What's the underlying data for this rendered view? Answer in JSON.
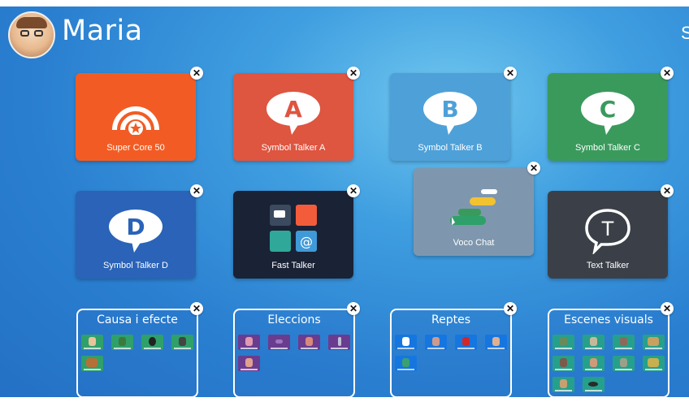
{
  "user": {
    "name": "Maria",
    "avatar_icon": "child-avatar-photo"
  },
  "header": {
    "settings_label": "S"
  },
  "tiles": [
    {
      "label": "Super Core 50",
      "color": "#f25c24",
      "icon": "super-core-icon"
    },
    {
      "label": "Symbol Talker A",
      "color": "#de5540",
      "icon": "speech-bubble-a-icon",
      "letter": "A"
    },
    {
      "label": "Symbol Talker B",
      "color": "#4ea0d8",
      "icon": "speech-bubble-b-icon",
      "letter": "B"
    },
    {
      "label": "Symbol Talker C",
      "color": "#3a9a5c",
      "icon": "speech-bubble-c-icon",
      "letter": "C"
    },
    {
      "label": "Symbol Talker D",
      "color": "#2a63b8",
      "icon": "speech-bubble-d-icon",
      "letter": "D"
    },
    {
      "label": "Fast Talker",
      "color": "#1a2235",
      "icon": "fast-talker-grid-icon"
    },
    {
      "label": "Voco Chat",
      "color": "#7f97ae",
      "icon": "voco-chat-icon"
    },
    {
      "label": "Text Talker",
      "color": "#3b4048",
      "icon": "speech-bubble-t-icon",
      "letter": "T"
    }
  ],
  "folders": [
    {
      "title": "Causa i efecte",
      "item_color": "#2fa06a",
      "item_count": 5
    },
    {
      "title": "Eleccions",
      "item_color": "#6a3c90",
      "item_count": 5
    },
    {
      "title": "Reptes",
      "item_color": "#1676e0",
      "item_count": 5
    },
    {
      "title": "Escenes visuals",
      "item_color": "#26a08a",
      "item_count": 10
    }
  ],
  "close_glyph": "✕"
}
